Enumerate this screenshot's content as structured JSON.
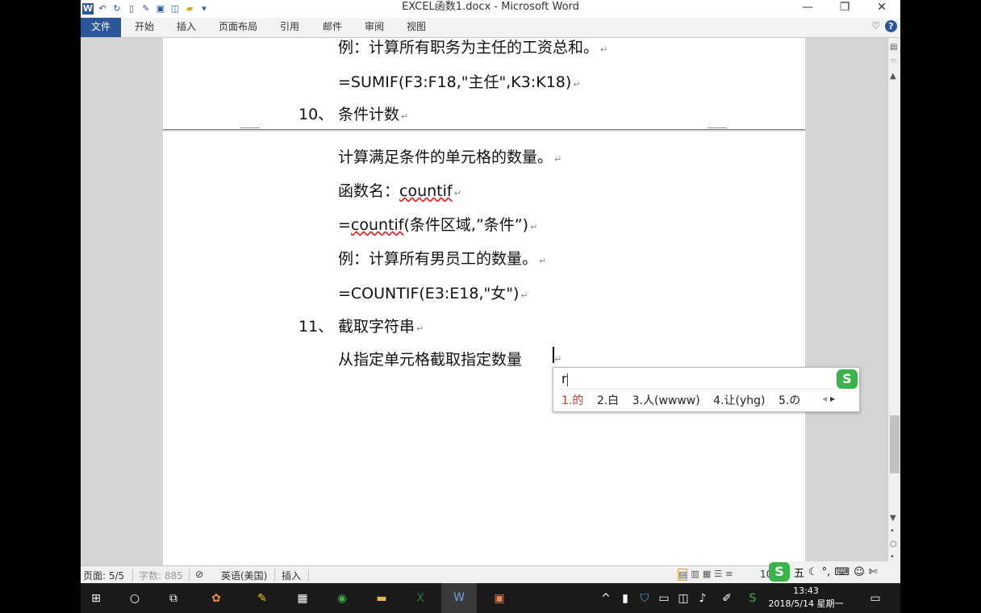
{
  "window": {
    "title": "EXCEL函数1.docx - Microsoft Word",
    "controls": {
      "minimize": "—",
      "restore": "❐",
      "close": "✕"
    }
  },
  "quick_access": {
    "icons": [
      "word-logo-icon",
      "undo-icon",
      "redo-icon",
      "new-doc-icon",
      "open-icon",
      "save-icon",
      "print-preview-icon",
      "folder-icon",
      "customize-icon"
    ]
  },
  "ribbon": {
    "file_tab": "文件",
    "tabs": [
      "开始",
      "插入",
      "页面布局",
      "引用",
      "邮件",
      "审阅",
      "视图"
    ]
  },
  "document": {
    "page1_lines": [
      "例：计算所有职务为主任的工资总和。",
      "=SUMIF(F3:F18,\"主任\",K3:K18)"
    ],
    "heading10_num": "10、",
    "heading10_text": "条件计数",
    "page2_lines": {
      "l1": "计算满足条件的单元格的数量。",
      "l2_prefix": "函数名：",
      "l2_fn": "countif",
      "l3_eq": "=",
      "l3_fn": "countif",
      "l3_rest": "(条件区域,”条件”)",
      "l4": "例：计算所有男员工的数量。",
      "l5": "=COUNTIF(E3:E18,\"女\")"
    },
    "heading11_num": "11、",
    "heading11_text": "截取字符串",
    "current_line": "从指定单元格截取指定数量"
  },
  "ime": {
    "input": "r",
    "candidates": [
      "1.的",
      "2.白",
      "3.人(wwww)",
      "4.让(yhg)",
      "5.の"
    ],
    "logo": "S"
  },
  "statusbar": {
    "page": "页面: 5/5",
    "words": "字数: 885",
    "language": "英语(美国)",
    "mode": "插入",
    "zoom": "10",
    "ime_mode": "五"
  },
  "taskbar": {
    "time": "13:43",
    "date": "2018/5/14 星期一"
  }
}
